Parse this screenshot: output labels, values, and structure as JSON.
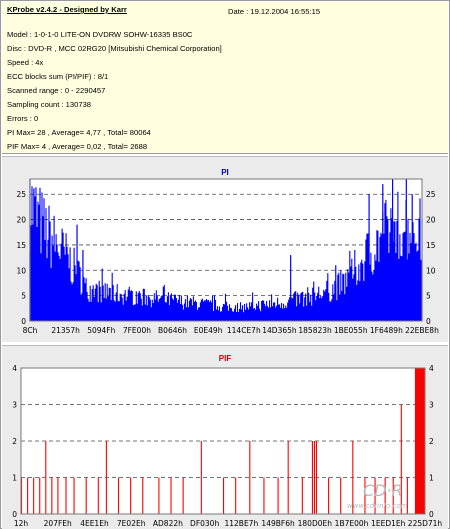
{
  "header": {
    "app_title": "KProbe v2.4.2 - Designed by Karr",
    "date": "Date : 19.12.2004 16:55:15"
  },
  "info_lines": [
    "Model : 1-0-1-0 LITE-ON DVDRW SOHW-16335 BS0C",
    "Disc : DVD-R , MCC 02RG20  [Mitsubishi Chemical Corporation]",
    "Speed : 4x",
    "ECC blocks sum (PI/PIF) : 8/1",
    "Scanned range : 0 - 2290457",
    "Sampling count : 130738",
    "Errors : 0",
    "PI Max= 28 , Average= 4,77 , Total= 80064",
    "PIF Max= 4 , Average= 0,02 , Total= 2688"
  ],
  "watermark": {
    "brand": "CD·R",
    "url": "www.cdrinfo.com"
  },
  "colors": {
    "pi": "#0000ff",
    "pif": "#ff0000",
    "grid": "#4a4a4a",
    "background": "#ffffff",
    "info_bg": "#ffffe0"
  },
  "chart_data": [
    {
      "type": "bar",
      "title": "PI",
      "x_ticks": [
        "8Ch",
        "21357h",
        "5094Fh",
        "7FE00h",
        "B0646h",
        "E0E49h",
        "114CE7h",
        "14D365h",
        "185823h",
        "1BE055h",
        "1F6489h",
        "22EBE8h"
      ],
      "ylim": [
        0,
        28
      ],
      "y_ticks": [
        0,
        5,
        10,
        15,
        20,
        25
      ],
      "grid": true,
      "profile": [
        [
          0.0,
          25
        ],
        [
          0.02,
          22
        ],
        [
          0.04,
          19
        ],
        [
          0.06,
          17
        ],
        [
          0.08,
          15
        ],
        [
          0.1,
          13
        ],
        [
          0.12,
          10
        ],
        [
          0.135,
          9
        ],
        [
          0.14,
          7
        ],
        [
          0.17,
          6.5
        ],
        [
          0.2,
          6
        ],
        [
          0.25,
          5.5
        ],
        [
          0.3,
          5
        ],
        [
          0.35,
          4.5
        ],
        [
          0.4,
          4
        ],
        [
          0.45,
          3.5
        ],
        [
          0.5,
          3
        ],
        [
          0.55,
          3
        ],
        [
          0.6,
          3.5
        ],
        [
          0.65,
          4
        ],
        [
          0.7,
          5
        ],
        [
          0.75,
          6
        ],
        [
          0.8,
          8
        ],
        [
          0.83,
          11
        ],
        [
          0.86,
          14
        ],
        [
          0.89,
          17
        ],
        [
          0.92,
          20
        ],
        [
          0.95,
          21
        ],
        [
          0.98,
          20
        ],
        [
          1.0,
          19
        ]
      ],
      "spikes": [
        [
          0.0,
          28
        ],
        [
          0.01,
          26
        ],
        [
          0.12,
          19
        ],
        [
          0.135,
          14
        ],
        [
          0.665,
          13
        ],
        [
          0.78,
          11
        ],
        [
          0.865,
          25
        ],
        [
          0.9,
          27
        ],
        [
          0.925,
          28
        ],
        [
          0.96,
          28
        ],
        [
          0.975,
          25
        ]
      ],
      "series": [
        {
          "name": "PI",
          "color": "#0000ff"
        }
      ]
    },
    {
      "type": "bar",
      "title": "PIF",
      "x_ticks": [
        "12h",
        "207FEh",
        "4EE1Eh",
        "7E02Eh",
        "AD822h",
        "DF030h",
        "112BE7h",
        "149BF6h",
        "180D0Eh",
        "1B7E00h",
        "1EED1Eh",
        "225D71h"
      ],
      "ylim": [
        0,
        4
      ],
      "y_ticks": [
        0,
        1,
        2,
        3,
        4
      ],
      "grid": true,
      "bars": [
        [
          0.0,
          1
        ],
        [
          0.015,
          1
        ],
        [
          0.03,
          1
        ],
        [
          0.045,
          1
        ],
        [
          0.06,
          2
        ],
        [
          0.075,
          1
        ],
        [
          0.09,
          1
        ],
        [
          0.11,
          1
        ],
        [
          0.13,
          1
        ],
        [
          0.16,
          1
        ],
        [
          0.19,
          1
        ],
        [
          0.21,
          2
        ],
        [
          0.24,
          1
        ],
        [
          0.27,
          1
        ],
        [
          0.3,
          1
        ],
        [
          0.34,
          1
        ],
        [
          0.37,
          1
        ],
        [
          0.4,
          1
        ],
        [
          0.445,
          2
        ],
        [
          0.5,
          1
        ],
        [
          0.53,
          1
        ],
        [
          0.565,
          2
        ],
        [
          0.6,
          1
        ],
        [
          0.635,
          1
        ],
        [
          0.66,
          2
        ],
        [
          0.695,
          1
        ],
        [
          0.72,
          2
        ],
        [
          0.725,
          2
        ],
        [
          0.73,
          2
        ],
        [
          0.76,
          1
        ],
        [
          0.79,
          1
        ],
        [
          0.82,
          2
        ],
        [
          0.85,
          1
        ],
        [
          0.875,
          1
        ],
        [
          0.9,
          1
        ],
        [
          0.92,
          1
        ],
        [
          0.94,
          3
        ],
        [
          0.955,
          1
        ],
        [
          0.975,
          4
        ],
        [
          0.98,
          4
        ],
        [
          0.985,
          4
        ],
        [
          0.99,
          4
        ],
        [
          0.995,
          4
        ]
      ],
      "series": [
        {
          "name": "PIF",
          "color": "#ff0000"
        }
      ]
    }
  ]
}
